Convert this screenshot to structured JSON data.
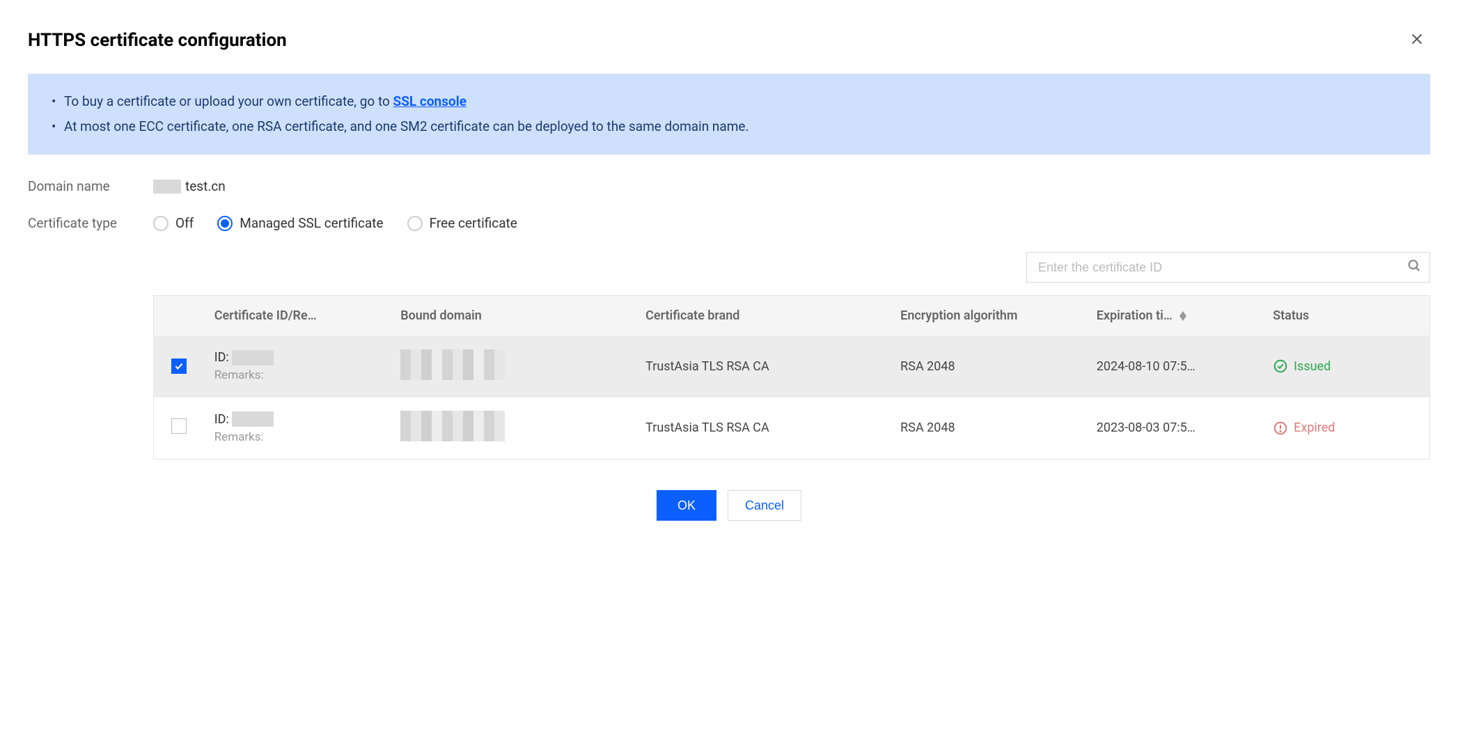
{
  "dialog": {
    "title": "HTTPS certificate configuration"
  },
  "info": {
    "line1_prefix": "To buy a certificate or upload your own certificate, go to ",
    "line1_link": "SSL console",
    "line2": "At most one ECC certificate, one RSA certificate, and one SM2 certificate can be deployed to the same domain name."
  },
  "form": {
    "domain_label": "Domain name",
    "domain_value_suffix": "test.cn",
    "cert_type_label": "Certificate type",
    "radios": {
      "off": "Off",
      "managed": "Managed SSL certificate",
      "free": "Free certificate",
      "selected": "managed"
    }
  },
  "search": {
    "placeholder": "Enter the certificate ID"
  },
  "table": {
    "headers": {
      "cert_id": "Certificate ID/Re…",
      "bound": "Bound domain",
      "brand": "Certificate brand",
      "alg": "Encryption algorithm",
      "exp": "Expiration ti…",
      "status": "Status"
    },
    "rows": [
      {
        "checked": true,
        "id_prefix": "ID:",
        "remarks_label": "Remarks:",
        "brand": "TrustAsia TLS RSA CA",
        "alg": "RSA 2048",
        "exp": "2024-08-10 07:5…",
        "status": "Issued",
        "status_type": "issued"
      },
      {
        "checked": false,
        "id_prefix": "ID:",
        "remarks_label": "Remarks:",
        "brand": "TrustAsia TLS RSA CA",
        "alg": "RSA 2048",
        "exp": "2023-08-03 07:5…",
        "status": "Expired",
        "status_type": "expired"
      }
    ]
  },
  "buttons": {
    "ok": "OK",
    "cancel": "Cancel"
  }
}
